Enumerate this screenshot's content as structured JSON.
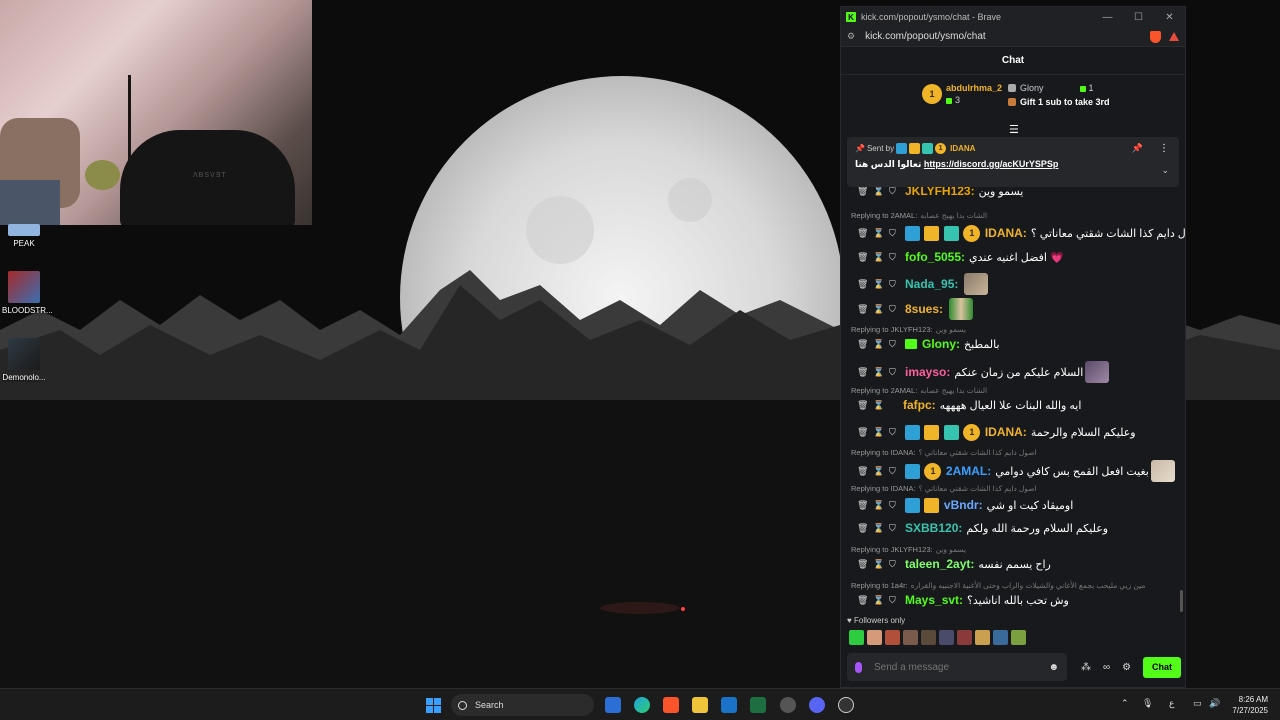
{
  "desktop": {
    "icons": [
      {
        "label": "PEAK"
      },
      {
        "label": "BLOODSTR..."
      },
      {
        "label": "Demonolo..."
      }
    ],
    "webcam_text": "ΛBSVƎT"
  },
  "browser": {
    "title": "kick.com/popout/ysmo/chat - Brave",
    "url": "kick.com/popout/ysmo/chat",
    "minimize": "—",
    "maximize": "☐",
    "close": "✕"
  },
  "chat": {
    "header": "Chat",
    "leaderboard": {
      "first": {
        "name": "abdulrhma_2",
        "count": "3",
        "rank": "1"
      },
      "second": {
        "name": "Glony",
        "count": "1"
      },
      "cta": "Gift 1 sub to take 3rd"
    },
    "pinned": {
      "sent_by_label": "Sent by",
      "sender": "IDANA",
      "message_prefix": "تعالوا الدس هنا",
      "link": "https://discord.gg/acKUrYSPSp"
    },
    "messages": [
      {
        "reply": "",
        "context": "",
        "user": "JKLYFH123:",
        "color": "#e9a400",
        "text": "يسمو وين"
      },
      {
        "reply": "Replying to 2AMAL:",
        "context": "الشات بدا يهبج عصابه",
        "user": "IDANA:",
        "color": "#f0b429",
        "text": "اصول دايم كذا الشات شقتي معاناتي ؟"
      },
      {
        "reply": "",
        "context": "",
        "user": "fofo_5055:",
        "color": "#53fc18",
        "text": "افضل اغنيه عندي 💗"
      },
      {
        "reply": "",
        "context": "",
        "user": "Nada_95:",
        "color": "#36c4b0",
        "text": ""
      },
      {
        "reply": "",
        "context": "",
        "user": "8sues:",
        "color": "#f0b429",
        "text": ""
      },
      {
        "reply": "Replying to JKLYFH123:",
        "context": "يسمو وين",
        "user": "Glony:",
        "color": "#53fc18",
        "text": "بالمطبخ"
      },
      {
        "reply": "",
        "context": "",
        "user": "imayso:",
        "color": "#ff5ea0",
        "text": "السلام عليكم من زمان عنكم"
      },
      {
        "reply": "Replying to 2AMAL:",
        "context": "الشات بدا يهبج عصابه",
        "user": "fafpc:",
        "color": "#f0b429",
        "text": "ايه والله البنات علا العيال ههههه"
      },
      {
        "reply": "",
        "context": "",
        "user": "IDANA:",
        "color": "#f0b429",
        "text": "وعليكم السلام والرحمة"
      },
      {
        "reply": "Replying to IDANA:",
        "context": "اصول دايم كذا الشات شقتي معاناتي ؟",
        "user": "2AMAL:",
        "color": "#3aa0ff",
        "text": "بغيت افعل القمح بس كافي دوامي"
      },
      {
        "reply": "Replying to IDANA:",
        "context": "اصول دايم كذا الشات شقتي معاناتي ؟",
        "user": "vBndr:",
        "color": "#6aa8ff",
        "text": "اوميقاد كيت او شي"
      },
      {
        "reply": "",
        "context": "",
        "user": "SXBB120:",
        "color": "#36c4b0",
        "text": "وعليكم السلام ورحمة الله ولكم"
      },
      {
        "reply": "Replying to JKLYFH123:",
        "context": "يسمو وين",
        "user": "taleen_2ayt:",
        "color": "#7fff6a",
        "text": "راح يسمم نفسه"
      },
      {
        "reply": "Replying to 1a4r:",
        "context": "مين زيي مليحب بجمع الأغاني والشيلات والراب وحتى الأغنية الاجنبيه والقراره",
        "user": "Mays_svt:",
        "color": "#53fc18",
        "text": "وش تحب بالله اناشيد؟"
      }
    ],
    "followers_only": "Followers only",
    "input_placeholder": "Send a message",
    "send_label": "Chat"
  },
  "taskbar": {
    "search_label": "Search",
    "time": "8:26 AM",
    "date": "7/27/2025",
    "lang": "ع"
  },
  "colors": {
    "kick_green": "#53fc18",
    "gold": "#f0b429"
  }
}
